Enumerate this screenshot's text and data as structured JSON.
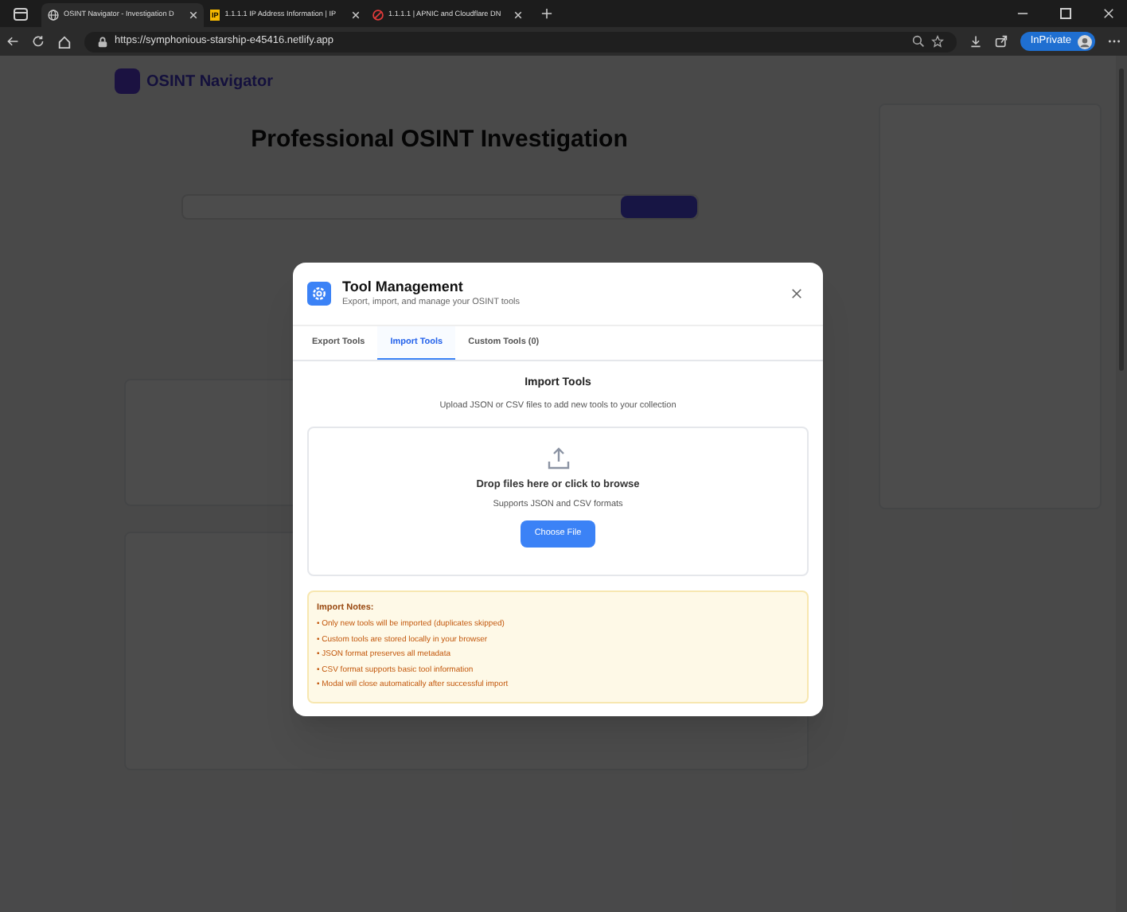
{
  "browser": {
    "tabs": [
      {
        "title": "OSINT Navigator - Investigation D",
        "selected": true,
        "kind": "globe"
      },
      {
        "title": "1.1.1.1 IP Address Information | IP",
        "selected": false,
        "kind": "badge",
        "icon_text": "IP"
      },
      {
        "title": "1.1.1.1 | APNIC and Cloudflare DN",
        "selected": false,
        "kind": "blocked"
      }
    ],
    "url": "https://symphonious-starship-e45416.netlify.app",
    "profile_label": "InPrivate"
  },
  "app": {
    "title": "OSINT Navigator",
    "hero_title": "Professional OSINT Investigation"
  },
  "modal": {
    "title": "Tool Management",
    "subtitle": "Export, import, and manage your OSINT tools",
    "tabs": [
      {
        "label": "Export Tools",
        "selected": false
      },
      {
        "label": "Import Tools",
        "selected": true
      },
      {
        "label": "Custom Tools (0)",
        "selected": false
      }
    ],
    "section_title": "Import Tools",
    "section_description": "Upload JSON or CSV files to add new tools to your collection",
    "dropzone": {
      "title": "Drop files here or click to browse",
      "hint": "Supports JSON and CSV formats",
      "button": "Choose File"
    },
    "notes": {
      "title": "Import Notes:",
      "items": [
        "• Only new tools will be imported (duplicates skipped)",
        "• Custom tools are stored locally in your browser",
        "• JSON format preserves all metadata",
        "• CSV format supports basic tool information",
        "• Modal will close automatically after successful import"
      ]
    }
  }
}
